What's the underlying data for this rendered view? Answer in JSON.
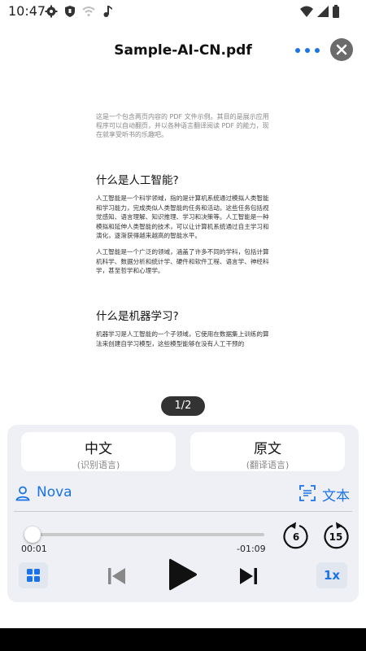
{
  "status_bar": {
    "time": "10:47",
    "icons": [
      "gear-icon",
      "shield-icon",
      "wifi-off-icon",
      "music-note-icon",
      "wifi-icon",
      "signal-icon",
      "battery-icon"
    ]
  },
  "header": {
    "title": "Sample-AI-CN.pdf",
    "more_icon": "more-horizontal-icon",
    "close_icon": "close-icon"
  },
  "document": {
    "intro": "这是一个包含两页内容的 PDF 文件示例。其目的是展示应用程序可以自动翻页，并以各种语言翻译阅读 PDF 的能力，现在就享受听书的乐趣吧。",
    "heading1": "什么是人工智能?",
    "para1": "人工智能是一个科学领域，指的是计算机系统通过模拟人类智能和学习能力，完成类似人类智能的任务和活动。这些任务包括视觉感知、语言理解、知识推理、学习和决策等。人工智能是一种模拟和延伸人类智能的技术，可以让计算机系统通过自主学习和演化，逐渐获得越来越高的智能水平。",
    "para2": "人工智能是一个广泛的领域，涵盖了许多不同的学科，包括计算机科学、数据分析和统计学、硬件和软件工程、语言学、神经科学，甚至哲学和心理学。",
    "heading2": "什么是机器学习?",
    "para3": "机器学习是人工智能的一个子领域，它使用在数据集上训练的算法来创建自学习模型，这些模型能够在没有人工干预的"
  },
  "page_indicator": "1/2",
  "player": {
    "source_lang": {
      "name": "中文",
      "caption": "(识别语言)"
    },
    "target_lang": {
      "name": "原文",
      "caption": "(翻译语言)"
    },
    "voice": {
      "name": "Nova",
      "icon": "person-icon"
    },
    "text_mode": {
      "label": "文本",
      "icon": "text-scan-icon"
    },
    "progress": 0.03,
    "elapsed": "00:01",
    "remaining": "-01:09",
    "rewind_seconds": "6",
    "forward_seconds": "15",
    "speed": "1x",
    "accent": "#1a73e8"
  }
}
